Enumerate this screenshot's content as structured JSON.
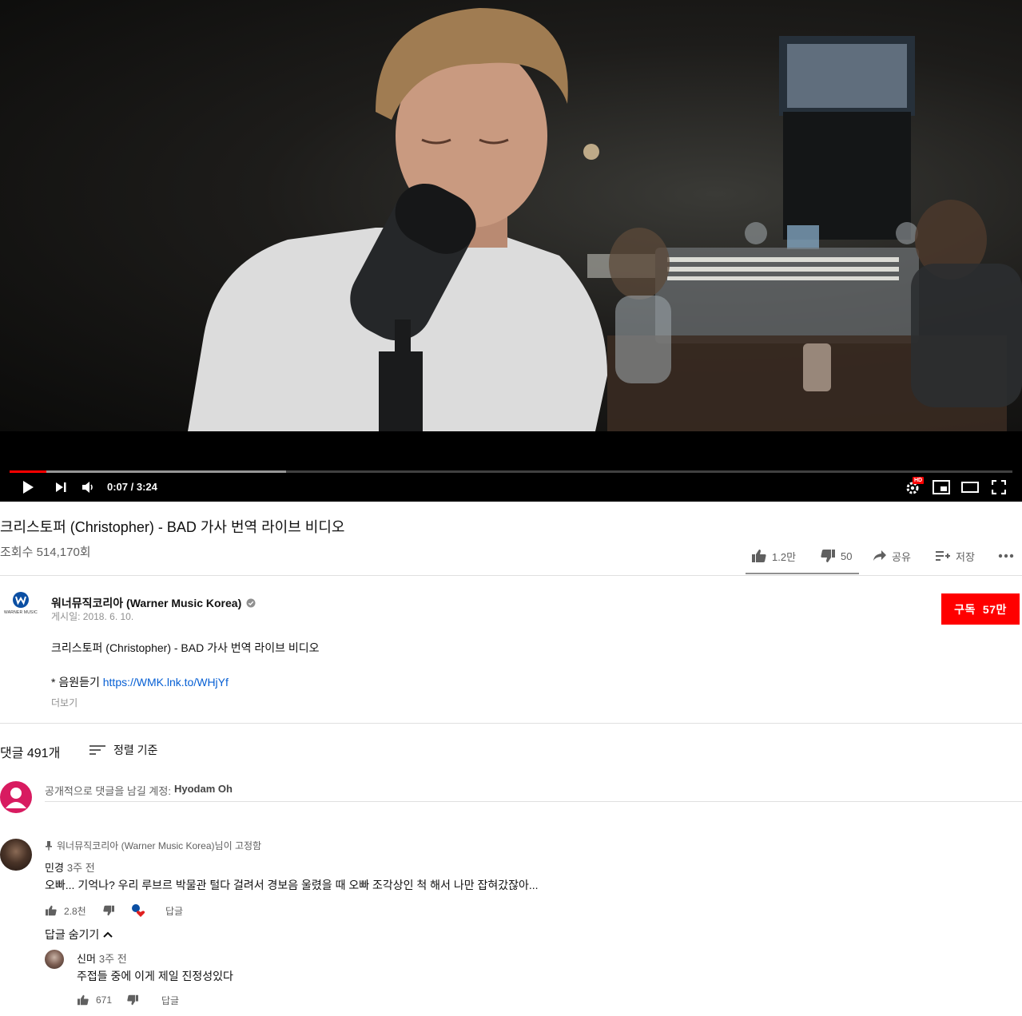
{
  "player": {
    "time_display": "0:07 / 3:24",
    "progress_played": 0.037,
    "progress_buffered": 0.276,
    "hd_badge": "HD",
    "colors": {
      "progress": "#ff0000"
    }
  },
  "video": {
    "title": "크리스토퍼 (Christopher) - BAD 가사 번역 라이브 비디오",
    "views": "조회수 514,170회"
  },
  "actions": {
    "like": "1.2만",
    "dislike": "50",
    "share": "공유",
    "save": "저장"
  },
  "channel": {
    "name": "워너뮤직코리아 (Warner Music Korea)",
    "logo_text": "WARNER MUSIC",
    "published": "게시일: 2018. 6. 10.",
    "subscribe_label": "구독",
    "subscriber_count": "57만",
    "colors": {
      "subscribe": "#ff0000"
    }
  },
  "description": {
    "line1": "크리스토퍼 (Christopher) - BAD 가사 번역 라이브 비디오",
    "line2_prefix": "* 음원듣기 ",
    "link": "https://WMK.lnk.to/WHjYf",
    "show_more": "더보기"
  },
  "comments": {
    "count": "댓글 491개",
    "sort": "정렬 기준",
    "input_placeholder": "공개적으로 댓글을 남길 계정:",
    "input_account": "Hyodam Oh",
    "items": [
      {
        "pinned_label": "워너뮤직코리아 (Warner Music Korea)님이 고정함",
        "author": "민경",
        "time": "3주 전",
        "text": "오빠... 기억나? 우리 루브르 박물관 털다 걸려서 경보음 울렸을 때 오빠 조각상인 척 해서 나만 잡혀갔잖아...",
        "likes": "2.8천",
        "reply": "답글",
        "hide_replies": "답글 숨기기",
        "replies": [
          {
            "author": "신머",
            "time": "3주 전",
            "text": "주접들 중에 이게 제일 진정성있다",
            "likes": "671",
            "reply": "답글"
          }
        ]
      }
    ]
  }
}
